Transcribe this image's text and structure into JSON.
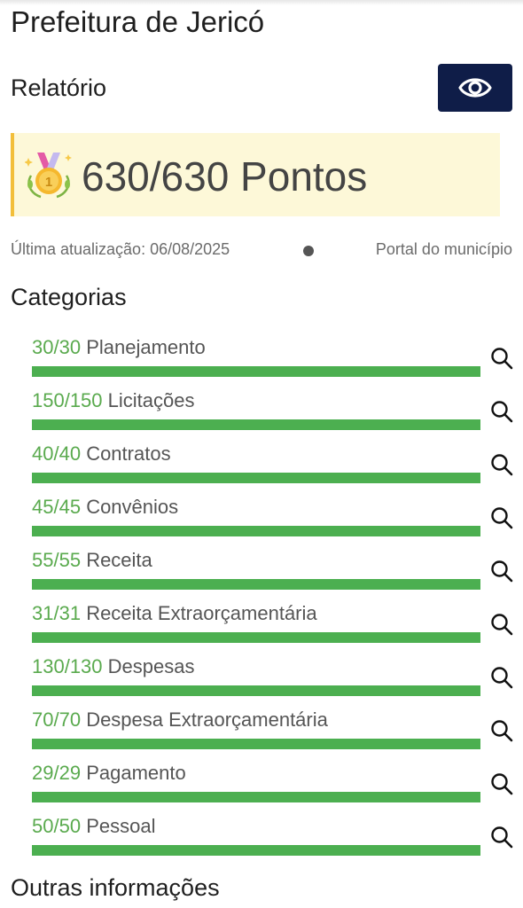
{
  "header": {
    "title": "Prefeitura de Jericó"
  },
  "report": {
    "label": "Relatório",
    "view_button_icon": "eye-icon"
  },
  "score": {
    "medal_icon": "gold-medal-icon",
    "text": "630/630 Pontos",
    "progress": 1.0
  },
  "meta": {
    "last_update": "Última atualização: 06/08/2025",
    "portal_link": "Portal do município"
  },
  "categories_title": "Categorias",
  "categories": [
    {
      "score": "30/30",
      "name": "Planejamento",
      "progress": 1.0
    },
    {
      "score": "150/150",
      "name": "Licitações",
      "progress": 1.0
    },
    {
      "score": "40/40",
      "name": "Contratos",
      "progress": 1.0
    },
    {
      "score": "45/45",
      "name": "Convênios",
      "progress": 1.0
    },
    {
      "score": "55/55",
      "name": "Receita",
      "progress": 1.0
    },
    {
      "score": "31/31",
      "name": "Receita Extraorçamentária",
      "progress": 1.0
    },
    {
      "score": "130/130",
      "name": "Despesas",
      "progress": 1.0
    },
    {
      "score": "70/70",
      "name": "Despesa Extraorçamentária",
      "progress": 1.0
    },
    {
      "score": "29/29",
      "name": "Pagamento",
      "progress": 1.0
    },
    {
      "score": "50/50",
      "name": "Pessoal",
      "progress": 1.0
    }
  ],
  "other_info_title": "Outras informações",
  "colors": {
    "accent_navy": "#0f1d48",
    "progress_green": "#4caf50",
    "score_green": "#5aaa4e",
    "highlight_bg": "#fdf8d8",
    "highlight_border": "#f2be3a"
  }
}
